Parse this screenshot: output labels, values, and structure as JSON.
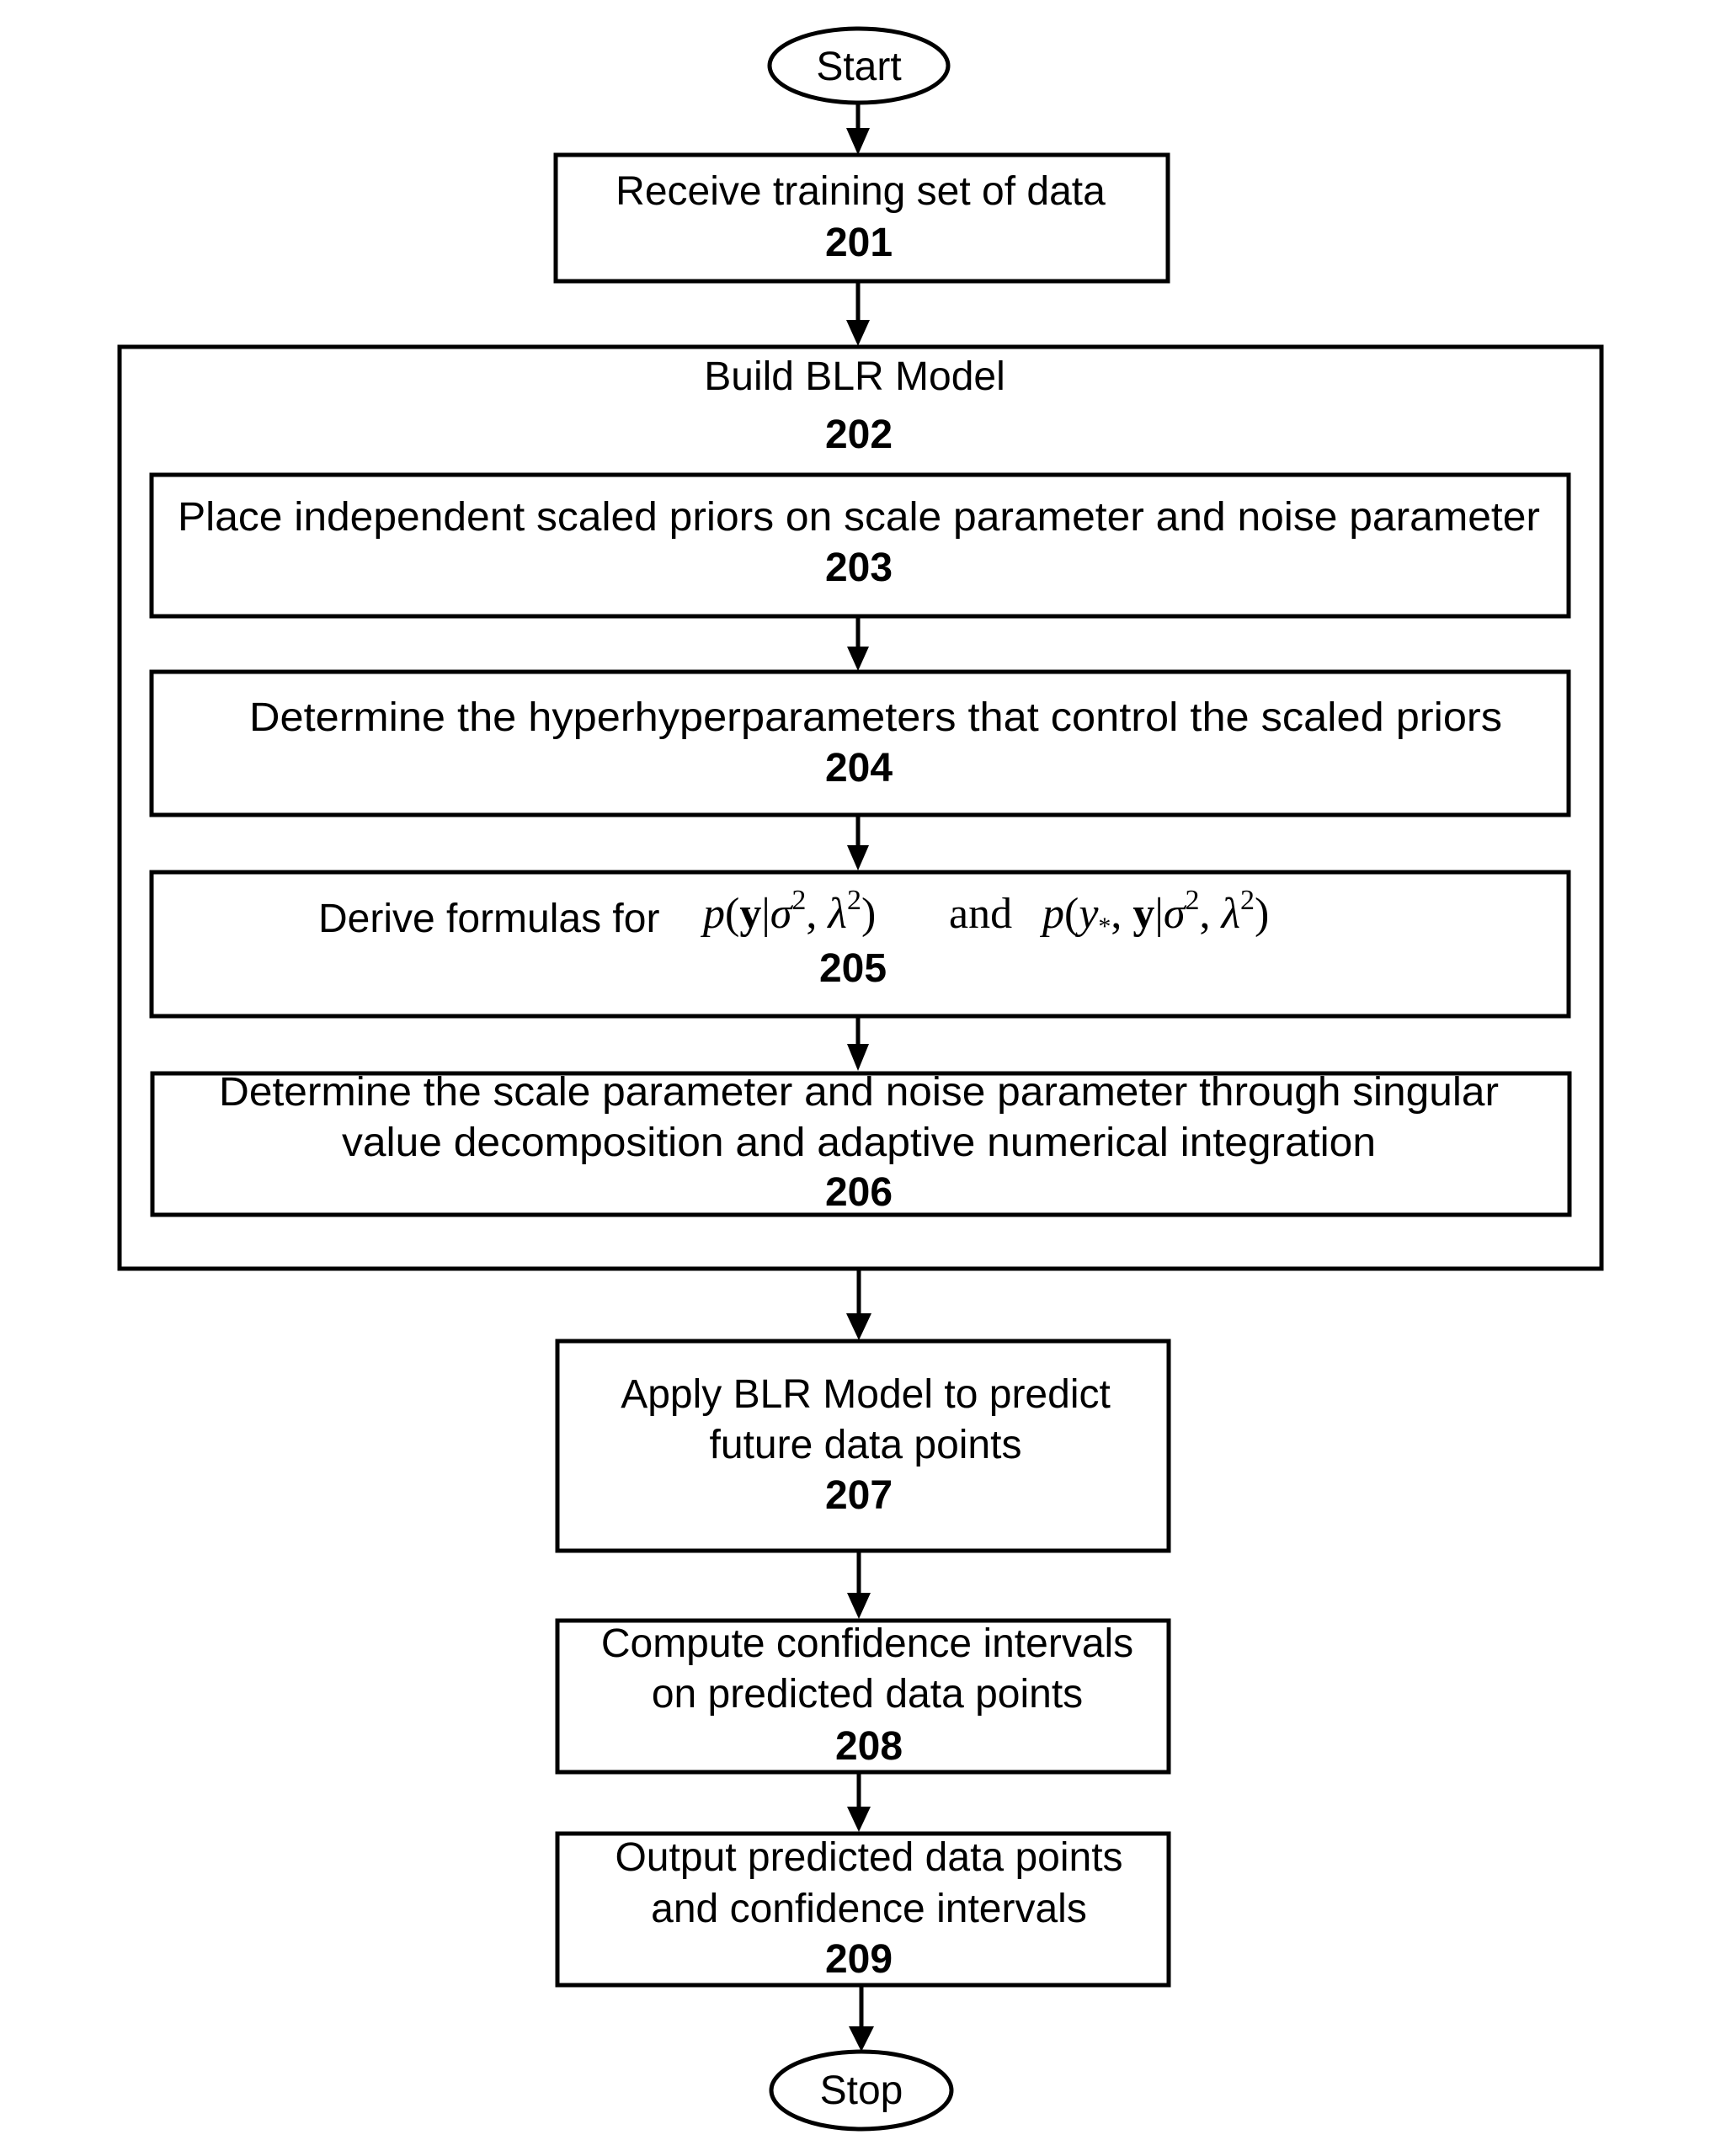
{
  "diagram": {
    "type": "flowchart",
    "start": {
      "label": "Start"
    },
    "stop": {
      "label": "Stop"
    },
    "steps": {
      "s201": {
        "lines": [
          "Receive training set of data"
        ],
        "ref": "201"
      },
      "s202": {
        "lines": [
          "Build BLR Model"
        ],
        "ref": "202"
      },
      "s203": {
        "lines": [
          "Place independent scaled priors on scale parameter and noise parameter"
        ],
        "ref": "203"
      },
      "s204": {
        "lines": [
          "Determine the hyperhyperparameters that control the scaled priors"
        ],
        "ref": "204"
      },
      "s205": {
        "prefix": "Derive formulas for",
        "formula1": {
          "p": "p",
          "open": "(",
          "y": "y",
          "bar": "|",
          "sigma": "σ",
          "sig_exp": "2",
          "comma": ", ",
          "lambda": "λ",
          "lam_exp": "2",
          "close": ")"
        },
        "conj": "and",
        "formula2": {
          "p": "p",
          "open": "(",
          "ystar": "y",
          "star": "*",
          "comma1": ", ",
          "y": "y",
          "bar": "|",
          "sigma": "σ",
          "sig_exp": "2",
          "comma2": ", ",
          "lambda": "λ",
          "lam_exp": "2",
          "close": ")"
        },
        "ref": "205"
      },
      "s206": {
        "lines": [
          "Determine the scale parameter and noise parameter through singular",
          "value decomposition and adaptive numerical integration"
        ],
        "ref": "206"
      },
      "s207": {
        "lines": [
          "Apply BLR Model to predict",
          "future data points"
        ],
        "ref": "207"
      },
      "s208": {
        "lines": [
          "Compute confidence intervals",
          "on predicted data points"
        ],
        "ref": "208"
      },
      "s209": {
        "lines": [
          "Output predicted data points",
          "and confidence intervals"
        ],
        "ref": "209"
      }
    },
    "edges": [
      [
        "Start",
        "201"
      ],
      [
        "201",
        "202"
      ],
      [
        "203",
        "204"
      ],
      [
        "204",
        "205"
      ],
      [
        "205",
        "206"
      ],
      [
        "202",
        "207"
      ],
      [
        "207",
        "208"
      ],
      [
        "208",
        "209"
      ],
      [
        "209",
        "Stop"
      ]
    ]
  }
}
